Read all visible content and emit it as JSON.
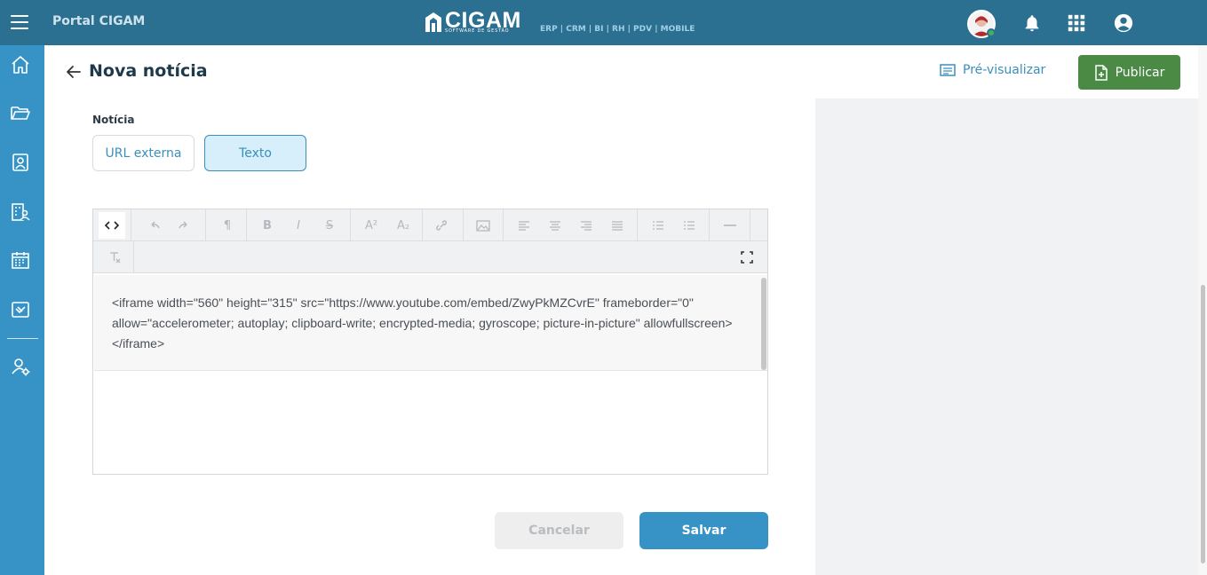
{
  "app": {
    "portal_title": "Portal CIGAM",
    "logo_text": "CIGAM",
    "logo_sub": "SOFTWARE DE GESTÃO",
    "logo_modules": "ERP | CRM | BI | RH | PDV | MOBILE"
  },
  "header": {
    "title": "Nova notícia",
    "preview_label": "Pré-visualizar",
    "publish_label": "Publicar"
  },
  "form": {
    "section_label": "Notícia",
    "toggle_options": [
      "URL externa",
      "Texto"
    ],
    "selected_option": "Texto",
    "editor_content": "<iframe width=\"560\" height=\"315\" src=\"https://www.youtube.com/embed/ZwyPkMZCvrE\" frameborder=\"0\" allow=\"accelerometer; autoplay; clipboard-write; encrypted-media; gyroscope; picture-in-picture\" allowfullscreen></iframe>"
  },
  "toolbar": {
    "buttons": [
      "code-view",
      "undo",
      "redo",
      "paragraph-format",
      "bold",
      "italic",
      "strikethrough",
      "superscript",
      "subscript",
      "insert-link",
      "insert-image",
      "align-left",
      "align-center",
      "align-right",
      "align-justify",
      "unordered-list",
      "ordered-list",
      "horizontal-line",
      "clear-formatting",
      "fullscreen"
    ]
  },
  "actions": {
    "cancel_label": "Cancelar",
    "save_label": "Salvar"
  },
  "colors": {
    "topbar": "#2b6f91",
    "sidebar": "#3793c5",
    "publish": "#4a8a45",
    "accent": "#3a8fbd"
  },
  "sidebar": {
    "items": [
      "home-icon",
      "folder-icon",
      "contacts-icon",
      "org-people-icon",
      "calendar-icon",
      "tickets-icon",
      "user-settings-icon"
    ]
  }
}
